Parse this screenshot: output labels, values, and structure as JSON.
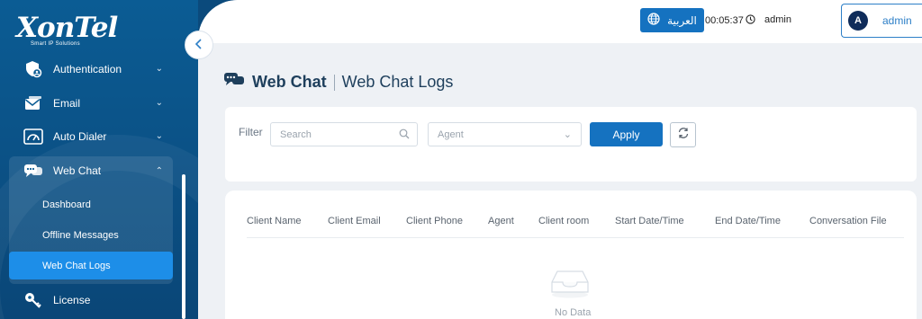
{
  "brand": {
    "logo_text": "XonTel",
    "logo_sub": "Smart IP Solutions"
  },
  "sidebar": {
    "items": [
      {
        "label": "Authentication",
        "icon": "shield-user-icon"
      },
      {
        "label": "Email",
        "icon": "email-icon"
      },
      {
        "label": "Auto Dialer",
        "icon": "gauge-icon"
      },
      {
        "label": "Web Chat",
        "icon": "chat-bubbles-icon",
        "expanded": true
      },
      {
        "label": "License",
        "icon": "key-icon"
      }
    ],
    "webchat_sub": [
      {
        "label": "Dashboard"
      },
      {
        "label": "Offline Messages"
      },
      {
        "label": "Web Chat Logs",
        "active": true
      }
    ]
  },
  "topbar": {
    "language_label": "العربية",
    "clock": "00:05:37",
    "username": "admin",
    "user_initial": "A",
    "user_menu_name": "admin"
  },
  "page": {
    "title": "Web Chat",
    "subtitle": "Web Chat Logs"
  },
  "filter": {
    "label": "Filter",
    "search_placeholder": "Search",
    "agent_placeholder": "Agent",
    "apply_label": "Apply"
  },
  "table": {
    "columns": [
      "Client Name",
      "Client Email",
      "Client Phone",
      "Agent",
      "Client room",
      "Start Date/Time",
      "End Date/Time",
      "Conversation File"
    ],
    "empty_text": "No Data"
  },
  "colors": {
    "sidebar": "#0b5c94",
    "accent": "#1572c0",
    "active_item": "#1d8ee8",
    "title": "#1e3f5c"
  }
}
